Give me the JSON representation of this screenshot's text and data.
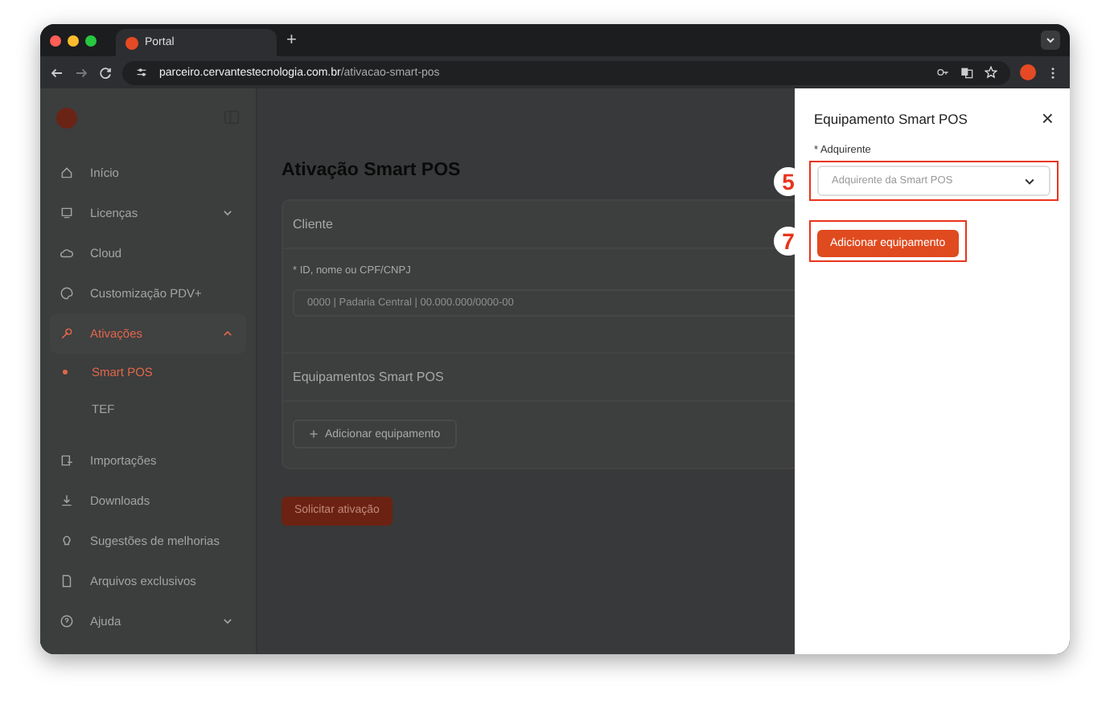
{
  "browser": {
    "tab": {
      "title": "Portal"
    },
    "new_tab": "+",
    "address": {
      "domain": "parceiro.cervantestecnologia.com.br",
      "path": "/ativacao-smart-pos"
    }
  },
  "sidebar": {
    "items": [
      {
        "label": "Início",
        "selected": false
      },
      {
        "label": "Licenças",
        "selected": false,
        "expanded": false
      },
      {
        "label": "Cloud",
        "selected": false
      },
      {
        "label": "Customização PDV+",
        "selected": false
      },
      {
        "label": "Ativações",
        "selected": true,
        "expanded": true,
        "children": [
          {
            "label": "Smart POS",
            "selected": true
          },
          {
            "label": "TEF",
            "selected": false
          }
        ]
      },
      {
        "label": "Importações",
        "selected": false
      },
      {
        "label": "Downloads",
        "selected": false
      },
      {
        "label": "Sugestões de melhorias",
        "selected": false
      },
      {
        "label": "Arquivos exclusivos",
        "selected": false
      },
      {
        "label": "Ajuda",
        "selected": false,
        "expanded": false
      }
    ]
  },
  "main": {
    "title": "Ativação Smart POS",
    "client_section": {
      "heading": "Cliente",
      "field": {
        "label": "* ID, nome ou CPF/CNPJ",
        "placeholder": "0000 | Padaria Central | 00.000.000/0000-00"
      }
    },
    "equipment_section": {
      "heading": "Equipamentos Smart POS",
      "add_button": "Adicionar equipamento"
    },
    "submit_button": "Solicitar ativação"
  },
  "drawer": {
    "title": "Equipamento Smart POS",
    "close": "×",
    "field": {
      "label": "* Adquirente",
      "placeholder": "Adquirente da Smart POS",
      "callout": "5"
    },
    "button": {
      "label": "Adicionar equipamento",
      "callout": "7"
    }
  }
}
